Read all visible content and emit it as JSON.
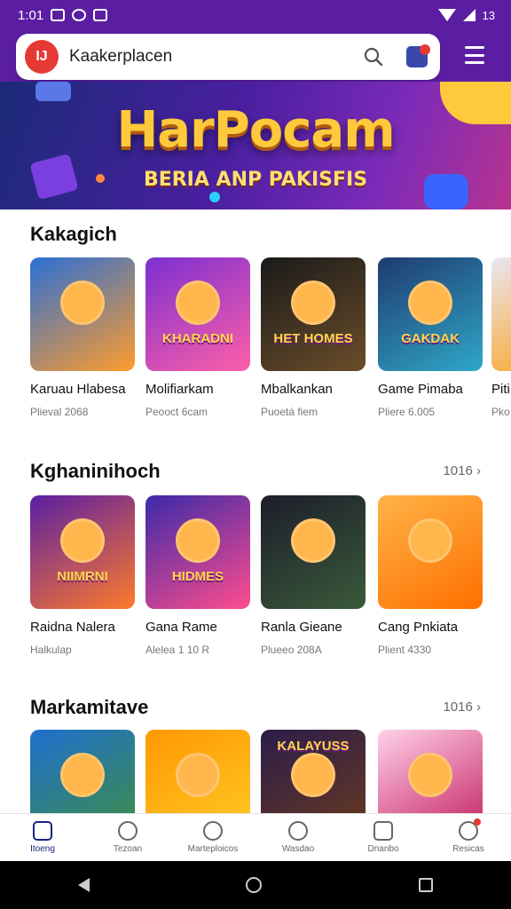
{
  "status_bar": {
    "time": "1:01",
    "battery": "13"
  },
  "search": {
    "value": "Kaakerplacen",
    "logo_text": "IJ"
  },
  "banner": {
    "title": "HarPocam",
    "subtitle": "BERIA ANP PAKISFIS"
  },
  "sections": [
    {
      "title": "Kakagich",
      "see_more": "",
      "cards": [
        {
          "title": "Karuau Hlabesa",
          "sub": "Plieval 2068",
          "thumb_text": "",
          "colors": [
            "#2b6fd6",
            "#ff9c2b"
          ]
        },
        {
          "title": "Molifiarkam",
          "sub": "Peooct 6cam",
          "thumb_text": "KHARADNI",
          "colors": [
            "#7b2fd0",
            "#ff5fa8"
          ]
        },
        {
          "title": "Mbalkankan",
          "sub": "Puoetá fiem",
          "thumb_text": "HET HOMES",
          "colors": [
            "#1a1a1a",
            "#6b4d2a"
          ]
        },
        {
          "title": "Game Pimaba",
          "sub": "Pliere 6.005",
          "thumb_text": "GAKDAK",
          "colors": [
            "#1f3b6f",
            "#2fa7c8"
          ]
        },
        {
          "title": "Piti",
          "sub": "Pko",
          "thumb_text": "",
          "colors": [
            "#e8e8f5",
            "#ff9800"
          ]
        }
      ]
    },
    {
      "title": "Kghaninihoch",
      "see_more": "1016 ›",
      "cards": [
        {
          "title": "Raidna Nalera",
          "sub": "Halkulap",
          "thumb_text": "NIIMRNI",
          "colors": [
            "#5a1fa3",
            "#ff7a2b"
          ]
        },
        {
          "title": "Gana Rame",
          "sub": "Alelea 1 10 R",
          "thumb_text": "HIDMES",
          "colors": [
            "#3b2aa8",
            "#ff4d8d"
          ]
        },
        {
          "title": "Ranla Gieane",
          "sub": "Plueeo 208A",
          "thumb_text": "",
          "colors": [
            "#1d1d2b",
            "#3a5a3a"
          ]
        },
        {
          "title": "Cang Pnkiata",
          "sub": "Plient 4330",
          "thumb_text": "",
          "colors": [
            "#ffb347",
            "#ff6f00"
          ]
        }
      ]
    },
    {
      "title": "Markamitave",
      "see_more": "1016 ›",
      "cards": [
        {
          "title": "",
          "sub": "",
          "thumb_text": "",
          "colors": [
            "#1f6fd0",
            "#3f8f3f"
          ]
        },
        {
          "title": "",
          "sub": "",
          "thumb_text": "",
          "colors": [
            "#ff9800",
            "#ffca28"
          ]
        },
        {
          "title": "",
          "sub": "",
          "thumb_text": "KALAYUSS",
          "colors": [
            "#2b1d4a",
            "#6b3a1f"
          ]
        },
        {
          "title": "",
          "sub": "",
          "thumb_text": "",
          "colors": [
            "#ffd1e8",
            "#c2185b"
          ]
        }
      ]
    }
  ],
  "bottom_nav": [
    {
      "label": "Itoeng",
      "icon": "home-icon",
      "active": true
    },
    {
      "label": "Tezoan",
      "icon": "compass-icon",
      "active": false
    },
    {
      "label": "Marteploicos",
      "icon": "people-icon",
      "active": false
    },
    {
      "label": "Wasdao",
      "icon": "heart-icon",
      "active": false
    },
    {
      "label": "Dnanbo",
      "icon": "grid-icon",
      "active": false
    },
    {
      "label": "Resicas",
      "icon": "profile-icon",
      "active": false
    }
  ],
  "theme": {
    "header": "#5b1ea3",
    "active_nav": "#1a237e"
  }
}
